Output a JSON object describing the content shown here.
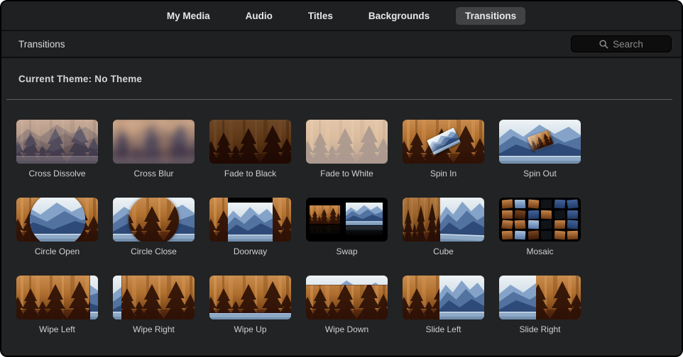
{
  "window": {
    "background": "#222324",
    "tab_bar_background": "#1f2021",
    "selected_tab_background": "#414244",
    "divider_light": "#5f5f5f",
    "label_text_color": "#d0d0d0"
  },
  "tab_bar": {
    "tabs": [
      {
        "label": "My Media",
        "selected": false
      },
      {
        "label": "Audio",
        "selected": false
      },
      {
        "label": "Titles",
        "selected": false
      },
      {
        "label": "Backgrounds",
        "selected": false
      },
      {
        "label": "Transitions",
        "selected": true
      }
    ]
  },
  "header": {
    "title": "Transitions",
    "search_placeholder": "Search",
    "search_icon": "magnifier-icon"
  },
  "theme_bar": {
    "text": "Current Theme: No Theme"
  },
  "transitions": [
    {
      "label": "Cross Dissolve",
      "effect": "cross-dissolve"
    },
    {
      "label": "Cross Blur",
      "effect": "cross-blur"
    },
    {
      "label": "Fade to Black",
      "effect": "fade-black"
    },
    {
      "label": "Fade to White",
      "effect": "fade-white"
    },
    {
      "label": "Spin In",
      "effect": "spin-in"
    },
    {
      "label": "Spin Out",
      "effect": "spin-out"
    },
    {
      "label": "Circle Open",
      "effect": "circle-open"
    },
    {
      "label": "Circle Close",
      "effect": "circle-close"
    },
    {
      "label": "Doorway",
      "effect": "doorway"
    },
    {
      "label": "Swap",
      "effect": "swap"
    },
    {
      "label": "Cube",
      "effect": "cube"
    },
    {
      "label": "Mosaic",
      "effect": "mosaic"
    },
    {
      "label": "Wipe Left",
      "effect": "wipe-left"
    },
    {
      "label": "Wipe Right",
      "effect": "wipe-right"
    },
    {
      "label": "Wipe Up",
      "effect": "wipe-up"
    },
    {
      "label": "Wipe Down",
      "effect": "wipe-down"
    },
    {
      "label": "Slide Left",
      "effect": "slide-left"
    },
    {
      "label": "Slide Right",
      "effect": "slide-right"
    }
  ],
  "scene_colors": {
    "forest_cliff": "#b0702f",
    "forest_trees": "#2d1106",
    "mountain_ridge": "#2e4a78",
    "mountain_sky": "#eef3f5",
    "mountain_water": "#8ea9c6"
  }
}
